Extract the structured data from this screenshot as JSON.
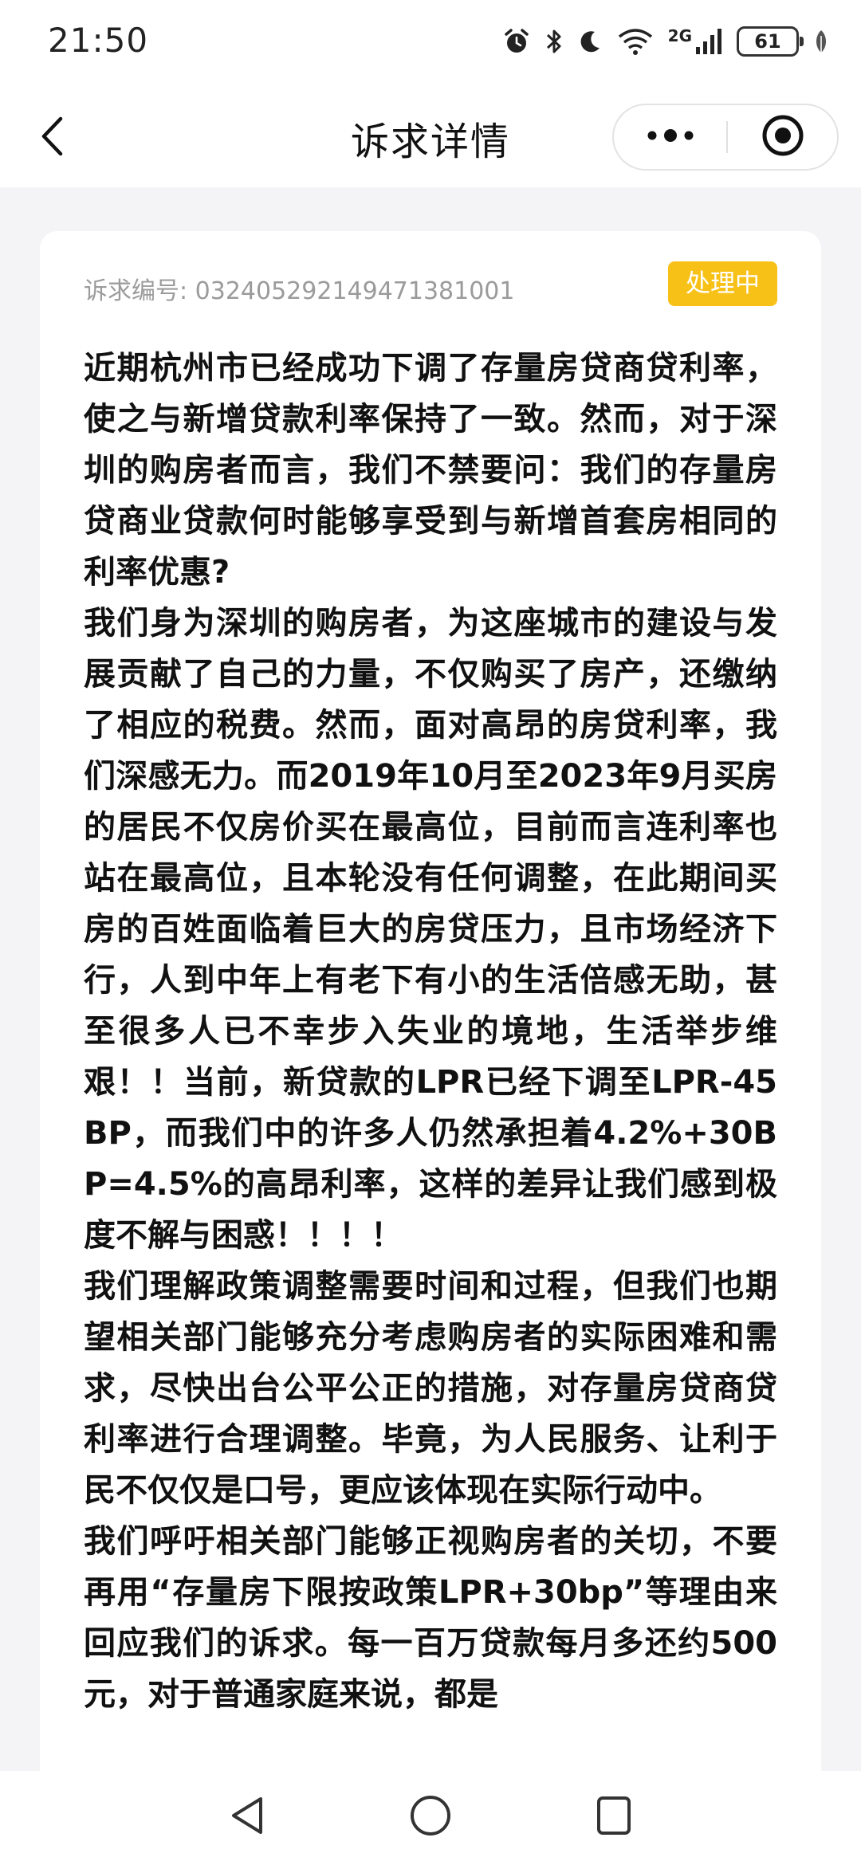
{
  "status_bar": {
    "time": "21:50",
    "network_label": "2G",
    "battery_level": "61",
    "icons": [
      "alarm-icon",
      "bluetooth-icon",
      "moon-icon",
      "wifi-icon",
      "signal-icon",
      "battery-icon",
      "leaf-icon"
    ]
  },
  "header": {
    "title": "诉求详情",
    "icons": [
      "back-icon",
      "more-icon",
      "close-target-icon"
    ]
  },
  "petition": {
    "number_label": "诉求编号:",
    "number": "032405292149471381001",
    "status": "处理中",
    "paragraphs": [
      "近期杭州市已经成功下调了存量房贷商贷利率，使之与新增贷款利率保持了一致。然而，对于深圳的购房者而言，我们不禁要问：我们的存量房贷商业贷款何时能够享受到与新增首套房相同的利率优惠?",
      "我们身为深圳的购房者，为这座城市的建设与发展贡献了自己的力量，不仅购买了房产，还缴纳了相应的税费。然而，面对高昂的房贷利率，我们深感无力。而2019年10月至2023年9月买房的居民不仅房价买在最高位，目前而言连利率也站在最高位，且本轮没有任何调整，在此期间买房的百姓面临着巨大的房贷压力，且市场经济下行，人到中年上有老下有小的生活倍感无助，甚至很多人已不幸步入失业的境地，生活举步维艰！！当前，新贷款的LPR已经下调至LPR-45BP，而我们中的许多人仍然承担着4.2%+30BP=4.5%的高昂利率，这样的差异让我们感到极度不解与困惑！！！！",
      "我们理解政策调整需要时间和过程，但我们也期望相关部门能够充分考虑购房者的实际困难和需求，尽快出台公平公正的措施，对存量房贷商贷利率进行合理调整。毕竟，为人民服务、让利于民不仅仅是口号，更应该体现在实际行动中。",
      "我们呼吁相关部门能够正视购房者的关切，不要再用“存量房下限按政策LPR+30bp”等理由来回应我们的诉求。每一百万贷款每月多还约500元，对于普通家庭来说，都是"
    ]
  },
  "bottom_nav": {
    "icons": [
      "back-triangle-icon",
      "home-circle-icon",
      "recents-square-icon"
    ]
  },
  "colors": {
    "badge": "#f8c117",
    "page_background": "#f4f4f6",
    "muted_text": "#9b9b9b"
  }
}
